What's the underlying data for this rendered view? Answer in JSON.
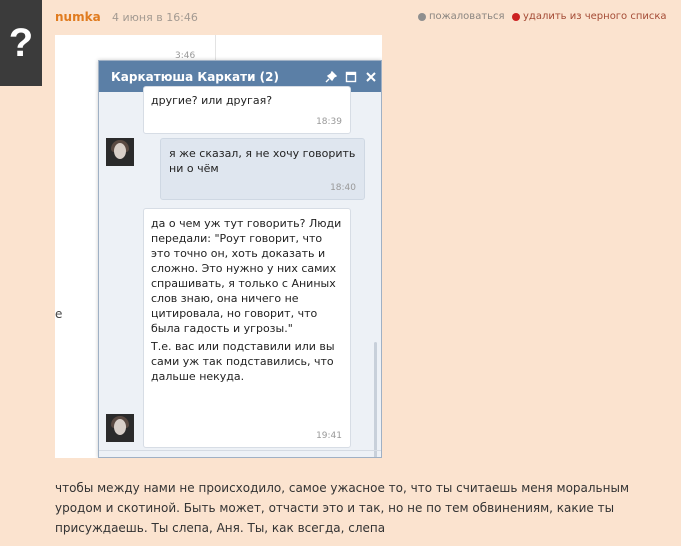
{
  "post": {
    "avatar_glyph": "?",
    "author": "numka",
    "date": "4 июня в 16:46",
    "report_label": "пожаловаться",
    "unblock_label": "удалить из черного списка",
    "body": "чтобы между нами не происходило, самое ужасное то, что ты считаешь меня моральным уродом и скотиной. Быть может, отчасти это и так, но не по тем обвинениям, какие ты присуждаешь. Ты слепа, Аня. Ты, как всегда, слепа"
  },
  "screenshot": {
    "top_time": "3:46",
    "edge_text": "е",
    "chat": {
      "title": "Каркатюша Каркати (2)",
      "icons": [
        "pin-icon",
        "maximize-icon",
        "close-icon"
      ],
      "messages": [
        {
          "dir": "in",
          "text": "другие? или другая?",
          "time": "18:39"
        },
        {
          "dir": "out",
          "text": "я же сказал, я не хочу говорить ни о чём",
          "time": "18:40"
        },
        {
          "dir": "in",
          "text": "да о чем уж тут говорить? Люди передали: \"Роут говорит, что это точно он, хоть доказать и сложно. Это нужно у них самих спрашивать, я только с Аниных слов знаю, она ничего не цитировала, но говорит, что была гадость и угрозы.\"",
          "text2": "Т.е. вас или подставили или вы сами уж так подставились, что дальше некуда.",
          "time": "19:41"
        }
      ]
    }
  }
}
